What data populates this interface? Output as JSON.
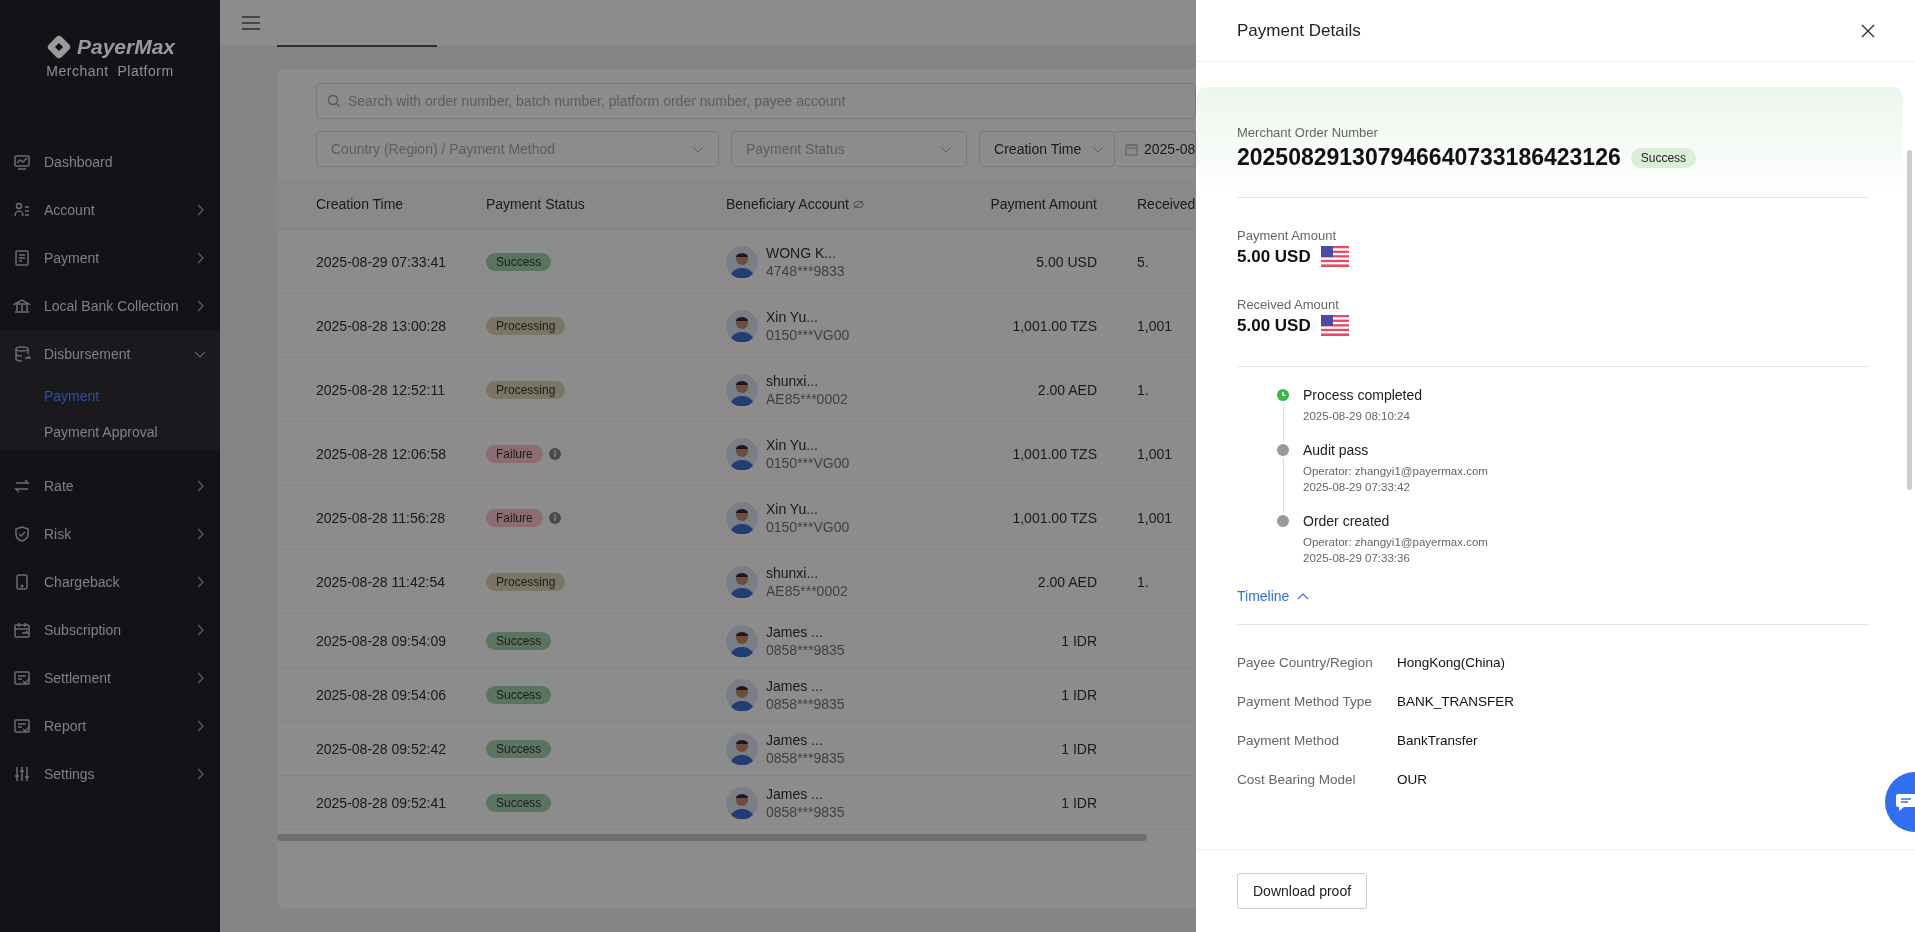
{
  "brand": {
    "name": "PayerMax",
    "subtitle": "Merchant  Platform"
  },
  "sidebar": {
    "items": [
      {
        "label": "Dashboard",
        "kind": "link"
      },
      {
        "label": "Account",
        "kind": "group",
        "expanded": false
      },
      {
        "label": "Payment",
        "kind": "group",
        "expanded": false
      },
      {
        "label": "Local Bank Collection",
        "kind": "group",
        "expanded": false
      },
      {
        "label": "Disbursement",
        "kind": "group",
        "expanded": true,
        "children": [
          {
            "label": "Payment",
            "selected": true
          },
          {
            "label": "Payment Approval",
            "selected": false
          }
        ]
      },
      {
        "label": "Rate",
        "kind": "group",
        "expanded": false
      },
      {
        "label": "Risk",
        "kind": "group",
        "expanded": false
      },
      {
        "label": "Chargeback",
        "kind": "group",
        "expanded": false
      },
      {
        "label": "Subscription",
        "kind": "group",
        "expanded": false
      },
      {
        "label": "Settlement",
        "kind": "group",
        "expanded": false
      },
      {
        "label": "Report",
        "kind": "group",
        "expanded": false
      },
      {
        "label": "Settings",
        "kind": "group",
        "expanded": false
      }
    ]
  },
  "search": {
    "placeholder": "Search with order number, batch number, platform order number, payee account"
  },
  "filters": {
    "country_method": {
      "placeholder": "Country (Region) / Payment Method"
    },
    "status": {
      "placeholder": "Payment Status"
    },
    "time_type": "Creation Time",
    "date": "2025-08"
  },
  "table": {
    "columns": [
      "Creation Time",
      "Payment Status",
      "Beneficiary Account",
      "Payment Amount",
      "Received"
    ],
    "rows": [
      {
        "time": "2025-08-29 07:33:41",
        "status": "Success",
        "color": "#5b7460",
        "info": false,
        "name": "WONG K...",
        "account": "4748***9833",
        "amount": "5.00 USD",
        "received": "5."
      },
      {
        "time": "2025-08-28 13:00:28",
        "status": "Processing",
        "color": "#7b7663",
        "info": false,
        "name": "Xin Yu...",
        "account": "0150***VG00",
        "amount": "1,001.00 TZS",
        "received": "1,001"
      },
      {
        "time": "2025-08-28 12:52:11",
        "status": "Processing",
        "color": "#7b7663",
        "info": false,
        "name": "shunxi...",
        "account": "AE85***0002",
        "amount": "2.00 AED",
        "received": "1."
      },
      {
        "time": "2025-08-28 12:06:58",
        "status": "Failure",
        "color": "#8a6c72",
        "info": true,
        "name": "Xin Yu...",
        "account": "0150***VG00",
        "amount": "1,001.00 TZS",
        "received": "1,001"
      },
      {
        "time": "2025-08-28 11:56:28",
        "status": "Failure",
        "color": "#8a6c72",
        "info": true,
        "name": "Xin Yu...",
        "account": "0150***VG00",
        "amount": "1,001.00 TZS",
        "received": "1,001"
      },
      {
        "time": "2025-08-28 11:42:54",
        "status": "Processing",
        "color": "#7b7663",
        "info": false,
        "name": "shunxi...",
        "account": "AE85***0002",
        "amount": "2.00 AED",
        "received": "1."
      },
      {
        "time": "2025-08-28 09:54:09",
        "status": "Success",
        "color": "#5b7460",
        "info": false,
        "name": "James ...",
        "account": "0858***9835",
        "amount": "1 IDR"
      },
      {
        "time": "2025-08-28 09:54:06",
        "status": "Success",
        "color": "#5b7460",
        "info": false,
        "name": "James ...",
        "account": "0858***9835",
        "amount": "1 IDR"
      },
      {
        "time": "2025-08-28 09:52:42",
        "status": "Success",
        "color": "#5b7460",
        "info": false,
        "name": "James ...",
        "account": "0858***9835",
        "amount": "1 IDR"
      },
      {
        "time": "2025-08-28 09:52:41",
        "status": "Success",
        "color": "#5b7460",
        "info": false,
        "name": "James ...",
        "account": "0858***9835",
        "amount": "1 IDR"
      }
    ]
  },
  "drawer": {
    "title": "Payment Details",
    "order_label": "Merchant Order Number",
    "order_number": "202508291307946640733186423126",
    "order_status": "Success",
    "amounts": [
      {
        "label": "Payment Amount",
        "value": "5.00 USD"
      },
      {
        "label": "Received Amount",
        "value": "5.00 USD"
      }
    ],
    "timeline": [
      {
        "title": "Process completed",
        "done": true,
        "lines": [
          "2025-08-29 08:10:24"
        ]
      },
      {
        "title": "Audit pass",
        "done": false,
        "lines": [
          "Operator: zhangyi1@payermax.com",
          "2025-08-29 07:33:42"
        ]
      },
      {
        "title": "Order created",
        "done": false,
        "lines": [
          "Operator: zhangyi1@payermax.com",
          "2025-08-29 07:33:36"
        ]
      }
    ],
    "timeline_toggle": {
      "label": "Timeline",
      "expanded": true
    },
    "fields": [
      {
        "label": "Payee Country/Region",
        "value": "HongKong(China)"
      },
      {
        "label": "Payment Method Type",
        "value": "BANK_TRANSFER"
      },
      {
        "label": "Payment Method",
        "value": "BankTransfer"
      },
      {
        "label": "Cost Bearing Model",
        "value": "OUR"
      }
    ],
    "download_button": "Download proof"
  }
}
